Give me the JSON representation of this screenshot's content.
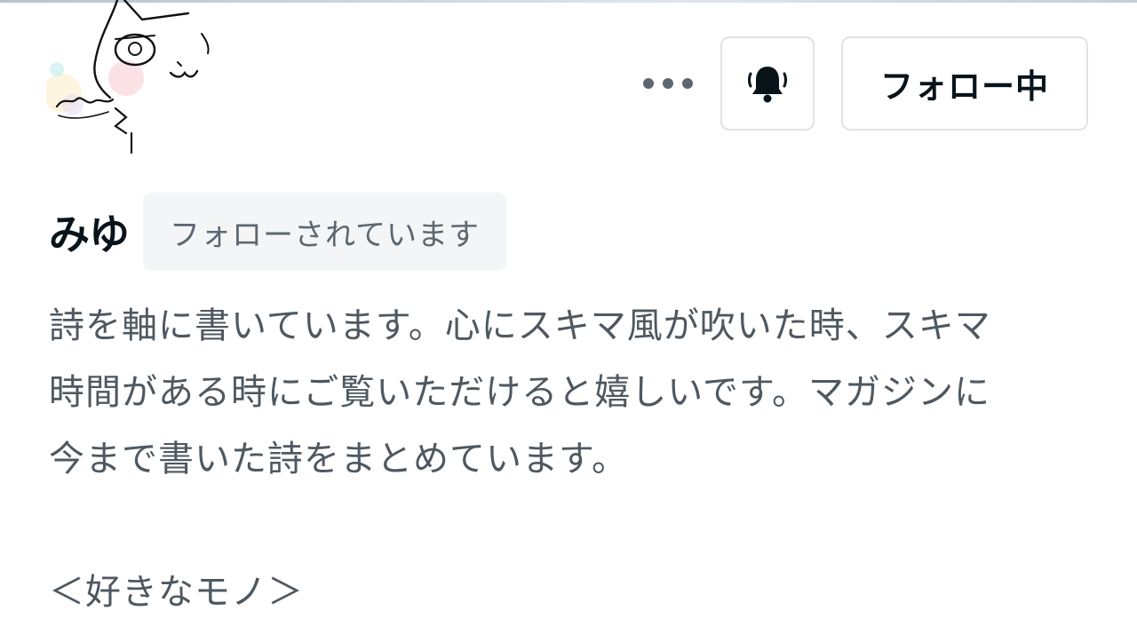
{
  "profile": {
    "name": "みゆ",
    "follows_you_badge": "フォローされています",
    "avatar_icon": "cat-drawing-avatar",
    "bio_lines": [
      "詩を軸に書いています。心にスキマ風が吹いた時、スキマ",
      "時間がある時にご覧いただけると嬉しいです。マガジンに",
      "今まで書いた詩をまとめています。"
    ],
    "likes_heading": "＜好きなモノ＞"
  },
  "actions": {
    "more_icon": "more-dots-icon",
    "bell_icon": "bell-ringing-icon",
    "follow_label": "フォロー中"
  },
  "colors": {
    "text_primary": "#08131a",
    "text_secondary": "#4f5860",
    "badge_bg": "#f3f5f6",
    "border": "#dfe3e6"
  }
}
